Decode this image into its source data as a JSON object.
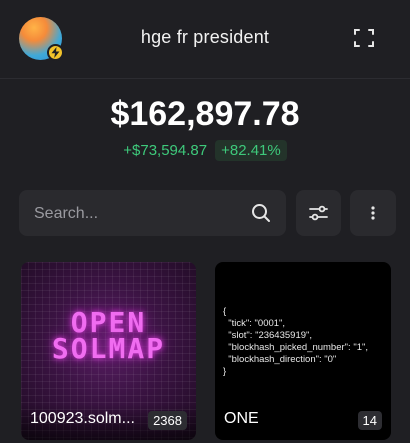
{
  "header": {
    "wallet_name": "hge fr president",
    "avatar_icon": "wallet-avatar",
    "badge_icon": "lightning-icon",
    "expand_icon": "expand-icon"
  },
  "portfolio": {
    "balance": "$162,897.78",
    "change_value": "+$73,594.87",
    "change_percent": "+82.41%",
    "positive_color": "#3ec97b"
  },
  "search": {
    "placeholder": "Search...",
    "value": ""
  },
  "toolbar": {
    "filter_icon": "sliders-icon",
    "more_icon": "more-vertical-icon"
  },
  "collections": [
    {
      "title": "100923.solm...",
      "count": "2368",
      "art_lines": [
        "OPEN",
        "SOLMAP"
      ]
    },
    {
      "title": "ONE",
      "count": "14",
      "json_text": "{\n  \"tick\": \"0001\",\n  \"slot\": \"236435919\",\n  \"blockhash_picked_number\": \"1\",\n  \"blockhash_direction\": \"0\"\n}"
    }
  ]
}
